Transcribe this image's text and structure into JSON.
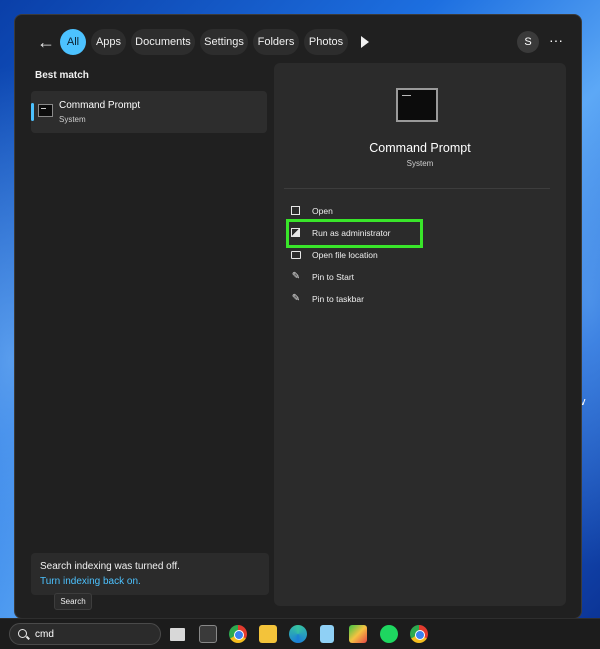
{
  "filters": {
    "back_label": "←",
    "tabs": [
      {
        "label": "All",
        "active": true
      },
      {
        "label": "Apps",
        "active": false
      },
      {
        "label": "Documents",
        "active": false
      },
      {
        "label": "Settings",
        "active": false
      },
      {
        "label": "Folders",
        "active": false
      },
      {
        "label": "Photos",
        "active": false
      }
    ],
    "avatar_initial": "S",
    "more_label": "···"
  },
  "results": {
    "section_label": "Best match",
    "best_match": {
      "title": "Command Prompt",
      "subtitle": "System",
      "icon": "command-prompt-icon"
    }
  },
  "notice": {
    "text": "Search indexing was turned off.",
    "link": "Turn indexing back on."
  },
  "detail": {
    "title": "Command Prompt",
    "subtitle": "System",
    "actions": [
      {
        "label": "Open",
        "icon": "open-icon"
      },
      {
        "label": "Run as administrator",
        "icon": "shield-admin-icon",
        "highlighted": true
      },
      {
        "label": "Open file location",
        "icon": "folder-icon"
      },
      {
        "label": "Pin to Start",
        "icon": "pin-icon"
      },
      {
        "label": "Pin to taskbar",
        "icon": "pin-icon"
      }
    ]
  },
  "taskbar": {
    "tooltip": "Search",
    "search_value": "cmd",
    "apps": [
      "task-view-icon",
      "terminal-icon",
      "chrome-icon",
      "file-explorer-icon",
      "edge-icon",
      "notepad-icon",
      "bluestacks-icon",
      "spotify-icon",
      "chrome-icon"
    ]
  },
  "wallpaper": {
    "edge_text": "v"
  },
  "colors": {
    "accent": "#4cc2ff",
    "highlight": "#39e52a",
    "panel": "#202020"
  }
}
